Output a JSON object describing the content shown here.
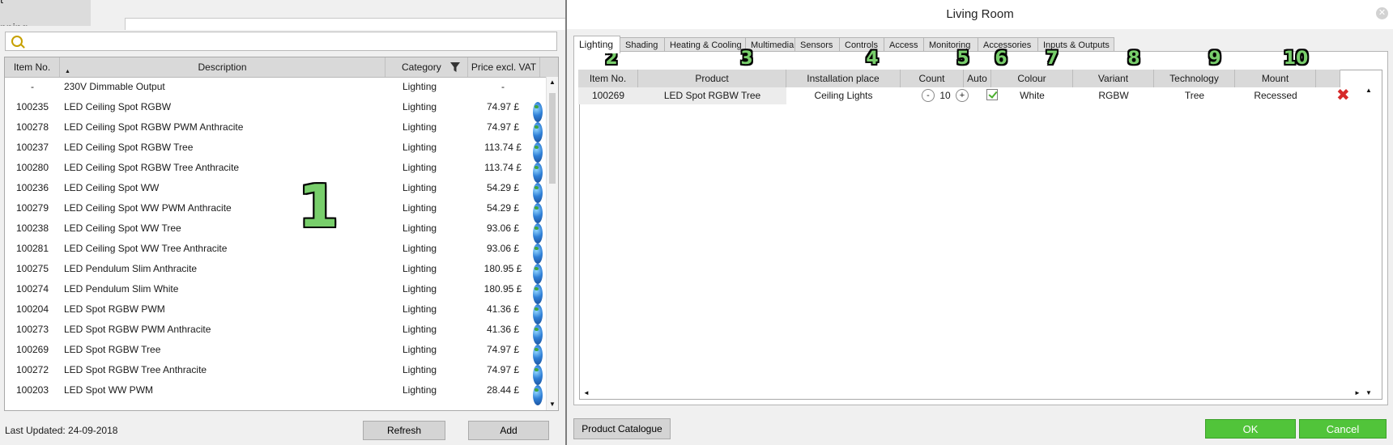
{
  "left": {
    "truncated_labels": [
      "t",
      "pping"
    ],
    "search": {
      "value": "",
      "placeholder": ""
    },
    "columns": [
      "Item No.",
      "Description",
      "Category",
      "Price excl. VAT"
    ],
    "rows": [
      {
        "item_no": "-",
        "description": "230V Dimmable Output",
        "category": "Lighting",
        "price": "-",
        "web": false
      },
      {
        "item_no": "100235",
        "description": "LED Ceiling Spot RGBW",
        "category": "Lighting",
        "price": "74.97 £",
        "web": true
      },
      {
        "item_no": "100278",
        "description": "LED Ceiling Spot RGBW PWM Anthracite",
        "category": "Lighting",
        "price": "74.97 £",
        "web": true
      },
      {
        "item_no": "100237",
        "description": "LED Ceiling Spot RGBW Tree",
        "category": "Lighting",
        "price": "113.74 £",
        "web": true
      },
      {
        "item_no": "100280",
        "description": "LED Ceiling Spot RGBW Tree Anthracite",
        "category": "Lighting",
        "price": "113.74 £",
        "web": true
      },
      {
        "item_no": "100236",
        "description": "LED Ceiling Spot WW",
        "category": "Lighting",
        "price": "54.29 £",
        "web": true
      },
      {
        "item_no": "100279",
        "description": "LED Ceiling Spot WW PWM Anthracite",
        "category": "Lighting",
        "price": "54.29 £",
        "web": true
      },
      {
        "item_no": "100238",
        "description": "LED Ceiling Spot WW Tree",
        "category": "Lighting",
        "price": "93.06 £",
        "web": true
      },
      {
        "item_no": "100281",
        "description": "LED Ceiling Spot WW Tree Anthracite",
        "category": "Lighting",
        "price": "93.06 £",
        "web": true
      },
      {
        "item_no": "100275",
        "description": "LED Pendulum Slim Anthracite",
        "category": "Lighting",
        "price": "180.95 £",
        "web": true
      },
      {
        "item_no": "100274",
        "description": "LED Pendulum Slim White",
        "category": "Lighting",
        "price": "180.95 £",
        "web": true
      },
      {
        "item_no": "100204",
        "description": "LED Spot RGBW PWM",
        "category": "Lighting",
        "price": "41.36 £",
        "web": true
      },
      {
        "item_no": "100273",
        "description": "LED Spot RGBW PWM Anthracite",
        "category": "Lighting",
        "price": "41.36 £",
        "web": true
      },
      {
        "item_no": "100269",
        "description": "LED Spot RGBW Tree",
        "category": "Lighting",
        "price": "74.97 £",
        "web": true
      },
      {
        "item_no": "100272",
        "description": "LED Spot RGBW Tree Anthracite",
        "category": "Lighting",
        "price": "74.97 £",
        "web": true
      },
      {
        "item_no": "100203",
        "description": "LED Spot WW PWM",
        "category": "Lighting",
        "price": "28.44 £",
        "web": true
      }
    ],
    "annotation": "1",
    "status": "Last Updated: 24-09-2018",
    "refresh_label": "Refresh",
    "add_label": "Add"
  },
  "dialog": {
    "title": "Living Room",
    "close_glyph": "✕",
    "tabs": [
      "Lighting",
      "Shading",
      "Heating & Cooling",
      "Multimedia",
      "Sensors",
      "Controls",
      "Access",
      "Monitoring",
      "Accessories",
      "Inputs & Outputs"
    ],
    "active_tab": "Lighting",
    "columns": [
      "Item No.",
      "Product",
      "Installation place",
      "Count",
      "Auto",
      "Colour",
      "Variant",
      "Technology",
      "Mount"
    ],
    "annotations": [
      "2",
      "3",
      "4",
      "5",
      "6",
      "7",
      "8",
      "9",
      "10"
    ],
    "row": {
      "item_no": "100269",
      "product": "LED Spot RGBW Tree",
      "installation_place": "Ceiling Lights",
      "count": "10",
      "auto": true,
      "colour": "White",
      "variant": "RGBW",
      "technology": "Tree",
      "mount": "Recessed"
    },
    "decrement_glyph": "-",
    "increment_glyph": "+",
    "delete_glyph": "✖",
    "catalogue_label": "Product Catalogue",
    "ok_label": "OK",
    "cancel_label": "Cancel"
  },
  "colors": {
    "accent_green": "#51c43a",
    "annotation_green": "#78ce6b",
    "delete_red": "#d62a2a"
  }
}
